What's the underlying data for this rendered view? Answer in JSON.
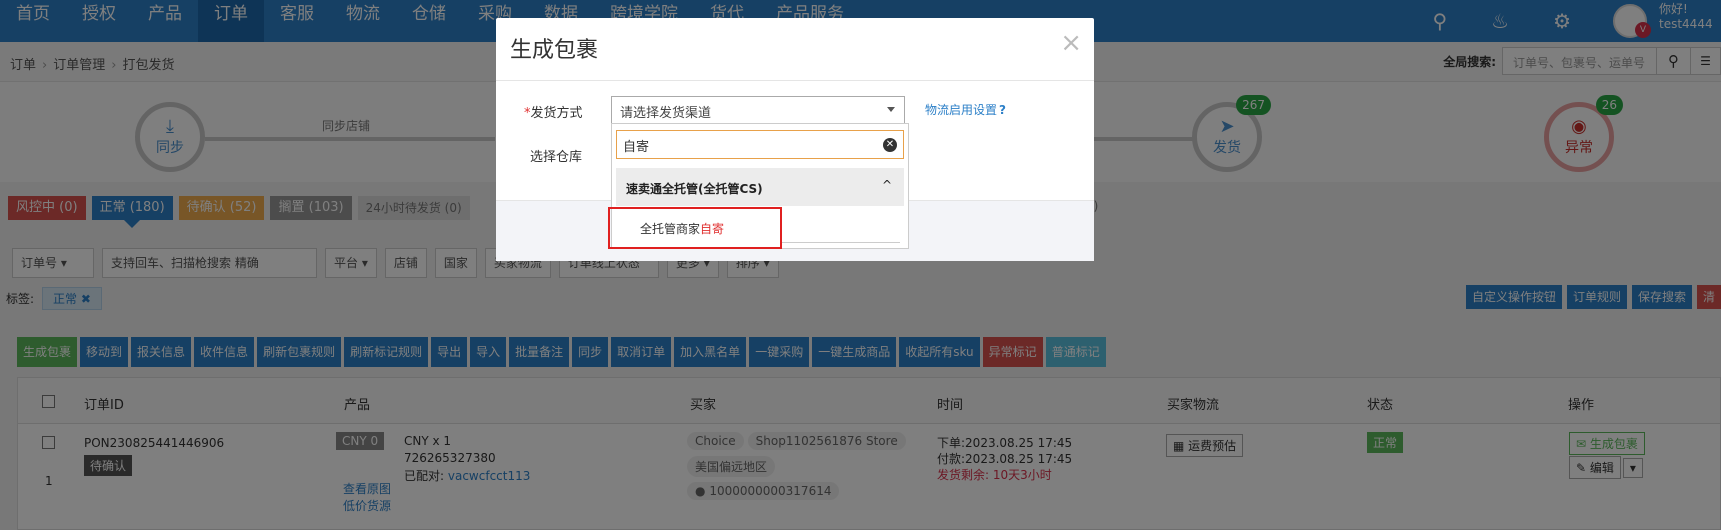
{
  "topnav": {
    "items": [
      "首页",
      "授权",
      "产品",
      "订单",
      "客服",
      "物流",
      "仓储",
      "采购",
      "数据",
      "跨境学院",
      "货代",
      "产品服务"
    ],
    "active_index": 3,
    "greeting": "你好!",
    "username": "test4444",
    "vip_badge": "V"
  },
  "breadcrumb": [
    "订单",
    "订单管理",
    "打包发货"
  ],
  "global_search": {
    "label": "全局搜索:",
    "placeholder": "订单号、包裹号、运单号"
  },
  "steps": {
    "sync_label": "同步",
    "sync_line_text": "同步店铺",
    "ship_label": "发货",
    "ship_count": "267",
    "error_label": "异常",
    "error_count": "26"
  },
  "status_tabs": [
    "风控中 (0)",
    "正常 (180)",
    "待确认 (52)",
    "搁置 (103)",
    "24小时待发货 (0)"
  ],
  "status_right_zero": "0)",
  "filters": {
    "order_no": "订单号",
    "search_placeholder": "支持回车、扫描枪搜索",
    "search_mode": "精确",
    "platform": "平台",
    "shop": "店铺",
    "country": "国家",
    "logistics": "买家物流",
    "online_status": "订单线上状态",
    "more": "更多",
    "sort": "排序"
  },
  "label_row": {
    "label": "标签:",
    "tag": "正常",
    "buttons": [
      "自定义操作按钮",
      "订单规则",
      "保存搜索",
      "清"
    ]
  },
  "toolbar": [
    "生成包裹",
    "移动到",
    "报关信息",
    "收件信息",
    "刷新包裹规则",
    "刷新标记规则",
    "导出",
    "导入",
    "批量备注",
    "同步",
    "取消订单",
    "加入黑名单",
    "一键采购",
    "一键生成商品",
    "收起所有sku",
    "异常标记",
    "普通标记"
  ],
  "table": {
    "headers": [
      "订单ID",
      "产品",
      "买家",
      "时间",
      "买家物流",
      "状态",
      "操作"
    ],
    "row": {
      "index": "1",
      "order_id": "PON230825441446906",
      "order_tag": "待确认",
      "cny_badge": "CNY 0",
      "product_price": "CNY x 1",
      "product_id": "726265327380",
      "matched_label": "已配对:",
      "matched_value": "vacwcfcct113",
      "view_image": "查看原图",
      "low_price": "低价货源",
      "buyer_choice": "Choice",
      "buyer_shop": "Shop1102561876 Store",
      "buyer_region": "美国偏远地区",
      "buyer_id": "1000000000317614",
      "order_time": "下单:2023.08.25 17:45",
      "pay_time": "付款:2023.08.25 17:45",
      "remaining": "发货剩余: 10天3小时",
      "freight_btn": "运费预估",
      "status": "正常",
      "create_pkg": "生成包裹",
      "edit": "编辑"
    }
  },
  "modal": {
    "title": "生成包裹",
    "ship_method_label": "发货方式",
    "warehouse_label": "选择仓库",
    "select_placeholder": "请选择发货渠道",
    "help_link": "物流启用设置",
    "dropdown": {
      "search_value": "自寄",
      "group": "速卖通全托管(全托管CS)",
      "option_prefix": "全托管商家",
      "option_highlight": "自寄"
    }
  }
}
